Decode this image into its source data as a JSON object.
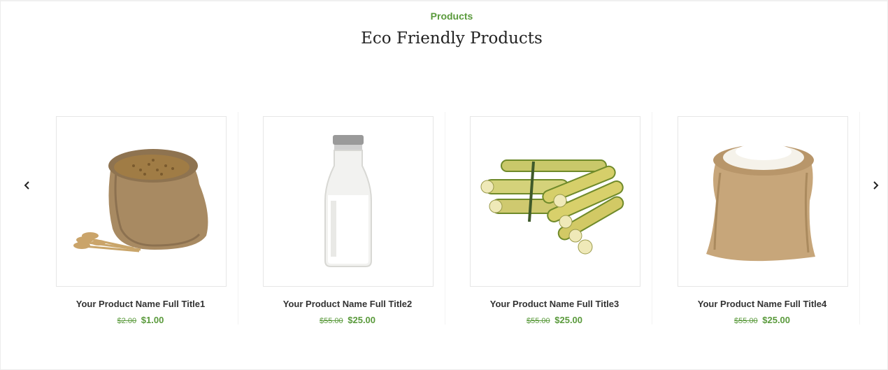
{
  "section": {
    "eyebrow": "Products",
    "title": "Eco Friendly Products"
  },
  "carousel": {
    "prev_icon": "chevron-left-icon",
    "next_icon": "chevron-right-icon",
    "products": [
      {
        "name": "Your Product Name Full Title1",
        "old_price": "$2.00",
        "price": "$1.00",
        "image": "wheat-sack"
      },
      {
        "name": "Your Product Name Full Title2",
        "old_price": "$55.00",
        "price": "$25.00",
        "image": "milk-bottle"
      },
      {
        "name": "Your Product Name Full Title3",
        "old_price": "$55.00",
        "price": "$25.00",
        "image": "sugarcane-bundle"
      },
      {
        "name": "Your Product Name Full Title4",
        "old_price": "$55.00",
        "price": "$25.00",
        "image": "rice-sack"
      }
    ]
  },
  "colors": {
    "accent": "#5a9a3c",
    "title": "#222222",
    "text": "#333333"
  }
}
